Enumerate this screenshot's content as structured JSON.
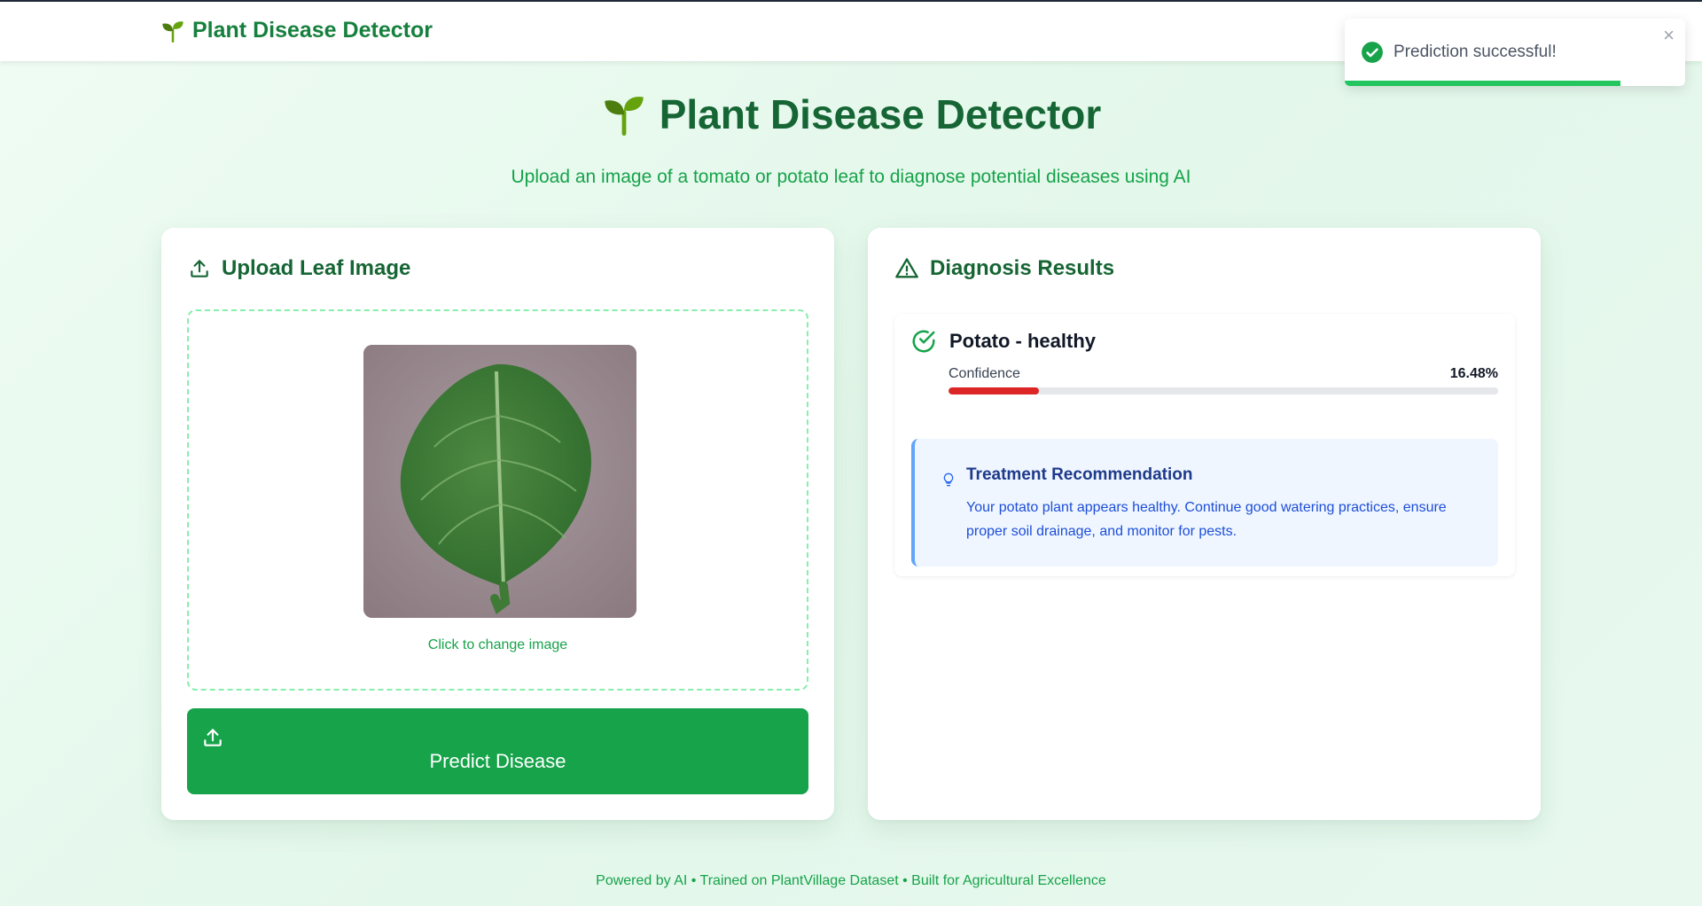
{
  "nav": {
    "brand": "Plant Disease Detector",
    "brand_icon": "sprout-icon"
  },
  "hero": {
    "title": "Plant Disease Detector",
    "subtitle": "Upload an image of a tomato or potato leaf to diagnose potential diseases using AI"
  },
  "upload": {
    "title": "Upload Leaf Image",
    "change_hint": "Click to change image",
    "predict_label": "Predict Disease"
  },
  "results": {
    "title": "Diagnosis Results",
    "diagnosis": "Potato - healthy",
    "confidence_label": "Confidence",
    "confidence_value": "16.48%",
    "confidence_fraction": 0.1648,
    "treatment_title": "Treatment Recommendation",
    "treatment_text": "Your potato plant appears healthy. Continue good watering practices, ensure proper soil drainage, and monitor for pests."
  },
  "footer": {
    "text": "Powered by AI • Trained on PlantVillage Dataset • Built for Agricultural Excellence"
  },
  "toast": {
    "message": "Prediction successful!",
    "close": "×",
    "progress_fraction": 0.81
  },
  "colors": {
    "primary": "#16a34a",
    "heading": "#166534",
    "confidence_bar": "#dc2626",
    "treatment_bg": "#eff6ff",
    "treatment_accent": "#60a5fa"
  }
}
